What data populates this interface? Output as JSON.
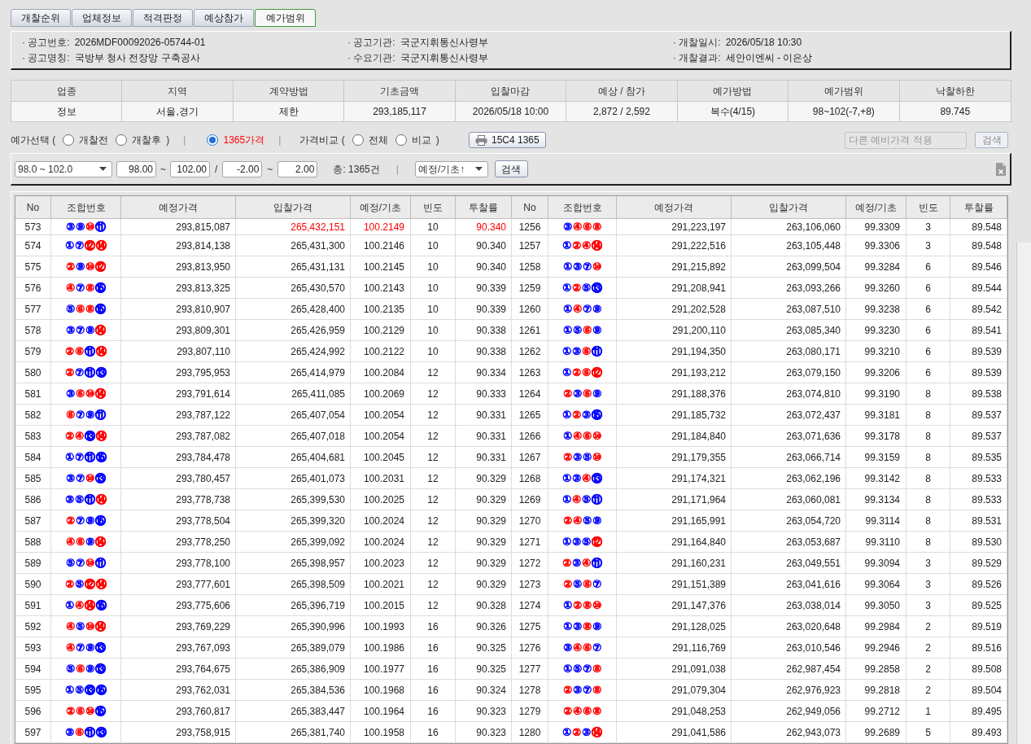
{
  "tabs": [
    {
      "label": "개찰순위",
      "selected": false
    },
    {
      "label": "업체정보",
      "selected": false
    },
    {
      "label": "적격판정",
      "selected": false
    },
    {
      "label": "예상참가",
      "selected": false
    },
    {
      "label": "예가범위",
      "selected": true
    }
  ],
  "notice_info": [
    {
      "label": "· 공고번호:",
      "value": "2026MDF00092026-05744-01"
    },
    {
      "label": "· 공고기관:",
      "value": "국군지휘통신사령부"
    },
    {
      "label": "· 개찰일시:",
      "value": "2026/05/18 10:30"
    },
    {
      "label": "· 공고명칭:",
      "value": "국방부 청사 전장망 구축공사"
    },
    {
      "label": "· 수요기관:",
      "value": "국군지휘통신사령부"
    },
    {
      "label": "· 개찰결과:",
      "value": "세안이엔씨 - 이은상"
    }
  ],
  "summary": {
    "columns": [
      "업종",
      "지역",
      "계약방법",
      "기초금액",
      "입찰마감",
      "예상 / 참가",
      "예가방법",
      "예가범위",
      "낙찰하한"
    ],
    "values": [
      "정보",
      "서울,경기",
      "제한",
      "293,185,117",
      "2026/05/18 10:00",
      "2,872 / 2,592",
      "복수(4/15)",
      "98~102(-7,+8)",
      "89.745"
    ]
  },
  "options": [
    {
      "kind": "text",
      "text": "예가선택 ("
    },
    {
      "kind": "radio",
      "label": "개찰전",
      "selected": false
    },
    {
      "kind": "radio",
      "label": "개찰후",
      "selected": false
    },
    {
      "kind": "text",
      "text": ")"
    },
    {
      "kind": "separator",
      "text": "|"
    },
    {
      "kind": "radio",
      "label": "1365가격",
      "selected": true
    },
    {
      "kind": "separator",
      "text": "|"
    },
    {
      "kind": "text",
      "text": "가격비교 ("
    },
    {
      "kind": "radio",
      "label": "전체",
      "selected": false
    },
    {
      "kind": "radio",
      "label": "비교",
      "selected": false
    },
    {
      "kind": "text",
      "text": ")"
    }
  ],
  "toolbar": {
    "print_button": "15C4 1365",
    "other_price": {
      "placeholder": "다른 예비가격 적용",
      "disabled": true
    },
    "search_button": {
      "label": "검색",
      "disabled": true
    }
  },
  "filter": {
    "range_select": "98.0 ~ 102.0",
    "base_from": "98.00",
    "base_tilde": "~",
    "base_to": "102.00",
    "slash": "/",
    "offset_from": "-2.00",
    "offset_tilde": "~",
    "offset_to": "2.00",
    "total": "총: 1365건",
    "separator": "|",
    "sort_select": "예정/기초↑",
    "search_button": "검색"
  },
  "table": {
    "columns": [
      "No",
      "조합번호",
      "예정가격",
      "입찰가격",
      "예정/기초",
      "빈도",
      "투찰률",
      "No",
      "조합번호",
      "예정가격",
      "입찰가격",
      "예정/기초",
      "빈도",
      "투찰률"
    ],
    "rows": [
      {
        "left": {
          "no": "573",
          "combo": [
            {
              "number": "③",
              "color": "#0000ff"
            },
            {
              "number": "⑨",
              "color": "#0000ff"
            },
            {
              "number": "⑩",
              "color": "#ff0000"
            },
            {
              "number": "⑪",
              "color": "#0000ff"
            }
          ],
          "estimated_price": "293,815,087",
          "bid_price": "265,432,151",
          "ratio": "100.2149",
          "frequency": "10",
          "bid_rate": "90.340",
          "highlighted": true
        },
        "right": {
          "no": "1256",
          "combo": [
            {
              "number": "③",
              "color": "#0000ff"
            },
            {
              "number": "④",
              "color": "#ff0000"
            },
            {
              "number": "⑥",
              "color": "#ff0000"
            },
            {
              "number": "⑧",
              "color": "#ff0000"
            }
          ],
          "estimated_price": "291,223,197",
          "bid_price": "263,106,060",
          "ratio": "99.3309",
          "frequency": "3",
          "bid_rate": "89.548",
          "highlighted": false
        }
      },
      {
        "left": {
          "no": "574",
          "combo": [
            {
              "number": "①",
              "color": "#0000ff"
            },
            {
              "number": "⑦",
              "color": "#0000ff"
            },
            {
              "number": "⑫",
              "color": "#ff0000"
            },
            {
              "number": "⑭",
              "color": "#ff0000"
            }
          ],
          "estimated_price": "293,814,138",
          "bid_price": "265,431,300",
          "ratio": "100.2146",
          "frequency": "10",
          "bid_rate": "90.340",
          "highlighted": false
        },
        "right": {
          "no": "1257",
          "combo": [
            {
              "number": "①",
              "color": "#0000ff"
            },
            {
              "number": "②",
              "color": "#ff0000"
            },
            {
              "number": "④",
              "color": "#ff0000"
            },
            {
              "number": "⑭",
              "color": "#ff0000"
            }
          ],
          "estimated_price": "291,222,516",
          "bid_price": "263,105,448",
          "ratio": "99.3306",
          "frequency": "3",
          "bid_rate": "89.548",
          "highlighted": false
        }
      },
      {
        "left": {
          "no": "575",
          "combo": [
            {
              "number": "②",
              "color": "#ff0000"
            },
            {
              "number": "⑨",
              "color": "#0000ff"
            },
            {
              "number": "⑩",
              "color": "#ff0000"
            },
            {
              "number": "⑫",
              "color": "#ff0000"
            }
          ],
          "estimated_price": "293,813,950",
          "bid_price": "265,431,131",
          "ratio": "100.2145",
          "frequency": "10",
          "bid_rate": "90.340",
          "highlighted": false
        },
        "right": {
          "no": "1258",
          "combo": [
            {
              "number": "①",
              "color": "#0000ff"
            },
            {
              "number": "③",
              "color": "#0000ff"
            },
            {
              "number": "⑦",
              "color": "#0000ff"
            },
            {
              "number": "⑩",
              "color": "#ff0000"
            }
          ],
          "estimated_price": "291,215,892",
          "bid_price": "263,099,504",
          "ratio": "99.3284",
          "frequency": "6",
          "bid_rate": "89.546",
          "highlighted": false
        }
      },
      {
        "left": {
          "no": "576",
          "combo": [
            {
              "number": "④",
              "color": "#ff0000"
            },
            {
              "number": "⑦",
              "color": "#0000ff"
            },
            {
              "number": "⑧",
              "color": "#ff0000"
            },
            {
              "number": "⑮",
              "color": "#0000ff"
            }
          ],
          "estimated_price": "293,813,325",
          "bid_price": "265,430,570",
          "ratio": "100.2143",
          "frequency": "10",
          "bid_rate": "90.339",
          "highlighted": false
        },
        "right": {
          "no": "1259",
          "combo": [
            {
              "number": "①",
              "color": "#0000ff"
            },
            {
              "number": "②",
              "color": "#ff0000"
            },
            {
              "number": "⑤",
              "color": "#0000ff"
            },
            {
              "number": "⑬",
              "color": "#0000ff"
            }
          ],
          "estimated_price": "291,208,941",
          "bid_price": "263,093,266",
          "ratio": "99.3260",
          "frequency": "6",
          "bid_rate": "89.544",
          "highlighted": false
        }
      },
      {
        "left": {
          "no": "577",
          "combo": [
            {
              "number": "⑤",
              "color": "#0000ff"
            },
            {
              "number": "⑥",
              "color": "#ff0000"
            },
            {
              "number": "⑧",
              "color": "#ff0000"
            },
            {
              "number": "⑮",
              "color": "#0000ff"
            }
          ],
          "estimated_price": "293,810,907",
          "bid_price": "265,428,400",
          "ratio": "100.2135",
          "frequency": "10",
          "bid_rate": "90.339",
          "highlighted": false
        },
        "right": {
          "no": "1260",
          "combo": [
            {
              "number": "①",
              "color": "#0000ff"
            },
            {
              "number": "④",
              "color": "#ff0000"
            },
            {
              "number": "⑦",
              "color": "#0000ff"
            },
            {
              "number": "⑨",
              "color": "#0000ff"
            }
          ],
          "estimated_price": "291,202,528",
          "bid_price": "263,087,510",
          "ratio": "99.3238",
          "frequency": "6",
          "bid_rate": "89.542",
          "highlighted": false
        }
      },
      {
        "left": {
          "no": "578",
          "combo": [
            {
              "number": "③",
              "color": "#0000ff"
            },
            {
              "number": "⑦",
              "color": "#0000ff"
            },
            {
              "number": "⑨",
              "color": "#0000ff"
            },
            {
              "number": "⑭",
              "color": "#ff0000"
            }
          ],
          "estimated_price": "293,809,301",
          "bid_price": "265,426,959",
          "ratio": "100.2129",
          "frequency": "10",
          "bid_rate": "90.338",
          "highlighted": false
        },
        "right": {
          "no": "1261",
          "combo": [
            {
              "number": "①",
              "color": "#0000ff"
            },
            {
              "number": "⑤",
              "color": "#0000ff"
            },
            {
              "number": "⑥",
              "color": "#ff0000"
            },
            {
              "number": "⑨",
              "color": "#0000ff"
            }
          ],
          "estimated_price": "291,200,110",
          "bid_price": "263,085,340",
          "ratio": "99.3230",
          "frequency": "6",
          "bid_rate": "89.541",
          "highlighted": false
        }
      },
      {
        "left": {
          "no": "579",
          "combo": [
            {
              "number": "②",
              "color": "#ff0000"
            },
            {
              "number": "⑥",
              "color": "#ff0000"
            },
            {
              "number": "⑪",
              "color": "#0000ff"
            },
            {
              "number": "⑭",
              "color": "#ff0000"
            }
          ],
          "estimated_price": "293,807,110",
          "bid_price": "265,424,992",
          "ratio": "100.2122",
          "frequency": "10",
          "bid_rate": "90.338",
          "highlighted": false
        },
        "right": {
          "no": "1262",
          "combo": [
            {
              "number": "①",
              "color": "#0000ff"
            },
            {
              "number": "③",
              "color": "#0000ff"
            },
            {
              "number": "⑥",
              "color": "#ff0000"
            },
            {
              "number": "⑪",
              "color": "#0000ff"
            }
          ],
          "estimated_price": "291,194,350",
          "bid_price": "263,080,171",
          "ratio": "99.3210",
          "frequency": "6",
          "bid_rate": "89.539",
          "highlighted": false
        }
      },
      {
        "left": {
          "no": "580",
          "combo": [
            {
              "number": "②",
              "color": "#ff0000"
            },
            {
              "number": "⑦",
              "color": "#0000ff"
            },
            {
              "number": "⑪",
              "color": "#0000ff"
            },
            {
              "number": "⑬",
              "color": "#0000ff"
            }
          ],
          "estimated_price": "293,795,953",
          "bid_price": "265,414,979",
          "ratio": "100.2084",
          "frequency": "12",
          "bid_rate": "90.334",
          "highlighted": false
        },
        "right": {
          "no": "1263",
          "combo": [
            {
              "number": "①",
              "color": "#0000ff"
            },
            {
              "number": "②",
              "color": "#ff0000"
            },
            {
              "number": "⑥",
              "color": "#ff0000"
            },
            {
              "number": "⑫",
              "color": "#ff0000"
            }
          ],
          "estimated_price": "291,193,212",
          "bid_price": "263,079,150",
          "ratio": "99.3206",
          "frequency": "6",
          "bid_rate": "89.539",
          "highlighted": false
        }
      },
      {
        "left": {
          "no": "581",
          "combo": [
            {
              "number": "③",
              "color": "#0000ff"
            },
            {
              "number": "⑥",
              "color": "#ff0000"
            },
            {
              "number": "⑩",
              "color": "#ff0000"
            },
            {
              "number": "⑭",
              "color": "#ff0000"
            }
          ],
          "estimated_price": "293,791,614",
          "bid_price": "265,411,085",
          "ratio": "100.2069",
          "frequency": "12",
          "bid_rate": "90.333",
          "highlighted": false
        },
        "right": {
          "no": "1264",
          "combo": [
            {
              "number": "②",
              "color": "#ff0000"
            },
            {
              "number": "③",
              "color": "#0000ff"
            },
            {
              "number": "⑥",
              "color": "#ff0000"
            },
            {
              "number": "⑨",
              "color": "#0000ff"
            }
          ],
          "estimated_price": "291,188,376",
          "bid_price": "263,074,810",
          "ratio": "99.3190",
          "frequency": "8",
          "bid_rate": "89.538",
          "highlighted": false
        }
      },
      {
        "left": {
          "no": "582",
          "combo": [
            {
              "number": "⑥",
              "color": "#ff0000"
            },
            {
              "number": "⑦",
              "color": "#0000ff"
            },
            {
              "number": "⑨",
              "color": "#0000ff"
            },
            {
              "number": "⑪",
              "color": "#0000ff"
            }
          ],
          "estimated_price": "293,787,122",
          "bid_price": "265,407,054",
          "ratio": "100.2054",
          "frequency": "12",
          "bid_rate": "90.331",
          "highlighted": false
        },
        "right": {
          "no": "1265",
          "combo": [
            {
              "number": "①",
              "color": "#0000ff"
            },
            {
              "number": "②",
              "color": "#ff0000"
            },
            {
              "number": "③",
              "color": "#0000ff"
            },
            {
              "number": "⑮",
              "color": "#0000ff"
            }
          ],
          "estimated_price": "291,185,732",
          "bid_price": "263,072,437",
          "ratio": "99.3181",
          "frequency": "8",
          "bid_rate": "89.537",
          "highlighted": false
        }
      },
      {
        "left": {
          "no": "583",
          "combo": [
            {
              "number": "②",
              "color": "#ff0000"
            },
            {
              "number": "④",
              "color": "#ff0000"
            },
            {
              "number": "⑬",
              "color": "#0000ff"
            },
            {
              "number": "⑭",
              "color": "#ff0000"
            }
          ],
          "estimated_price": "293,787,082",
          "bid_price": "265,407,018",
          "ratio": "100.2054",
          "frequency": "12",
          "bid_rate": "90.331",
          "highlighted": false
        },
        "right": {
          "no": "1266",
          "combo": [
            {
              "number": "①",
              "color": "#0000ff"
            },
            {
              "number": "④",
              "color": "#ff0000"
            },
            {
              "number": "⑥",
              "color": "#ff0000"
            },
            {
              "number": "⑩",
              "color": "#ff0000"
            }
          ],
          "estimated_price": "291,184,840",
          "bid_price": "263,071,636",
          "ratio": "99.3178",
          "frequency": "8",
          "bid_rate": "89.537",
          "highlighted": false
        }
      },
      {
        "left": {
          "no": "584",
          "combo": [
            {
              "number": "①",
              "color": "#0000ff"
            },
            {
              "number": "⑦",
              "color": "#0000ff"
            },
            {
              "number": "⑪",
              "color": "#0000ff"
            },
            {
              "number": "⑮",
              "color": "#0000ff"
            }
          ],
          "estimated_price": "293,784,478",
          "bid_price": "265,404,681",
          "ratio": "100.2045",
          "frequency": "12",
          "bid_rate": "90.331",
          "highlighted": false
        },
        "right": {
          "no": "1267",
          "combo": [
            {
              "number": "②",
              "color": "#ff0000"
            },
            {
              "number": "③",
              "color": "#0000ff"
            },
            {
              "number": "⑤",
              "color": "#0000ff"
            },
            {
              "number": "⑩",
              "color": "#ff0000"
            }
          ],
          "estimated_price": "291,179,355",
          "bid_price": "263,066,714",
          "ratio": "99.3159",
          "frequency": "8",
          "bid_rate": "89.535",
          "highlighted": false
        }
      },
      {
        "left": {
          "no": "585",
          "combo": [
            {
              "number": "③",
              "color": "#0000ff"
            },
            {
              "number": "⑦",
              "color": "#0000ff"
            },
            {
              "number": "⑩",
              "color": "#ff0000"
            },
            {
              "number": "⑬",
              "color": "#0000ff"
            }
          ],
          "estimated_price": "293,780,457",
          "bid_price": "265,401,073",
          "ratio": "100.2031",
          "frequency": "12",
          "bid_rate": "90.329",
          "highlighted": false
        },
        "right": {
          "no": "1268",
          "combo": [
            {
              "number": "①",
              "color": "#0000ff"
            },
            {
              "number": "③",
              "color": "#0000ff"
            },
            {
              "number": "④",
              "color": "#ff0000"
            },
            {
              "number": "⑬",
              "color": "#0000ff"
            }
          ],
          "estimated_price": "291,174,321",
          "bid_price": "263,062,196",
          "ratio": "99.3142",
          "frequency": "8",
          "bid_rate": "89.533",
          "highlighted": false
        }
      },
      {
        "left": {
          "no": "586",
          "combo": [
            {
              "number": "③",
              "color": "#0000ff"
            },
            {
              "number": "⑤",
              "color": "#0000ff"
            },
            {
              "number": "⑪",
              "color": "#0000ff"
            },
            {
              "number": "⑭",
              "color": "#ff0000"
            }
          ],
          "estimated_price": "293,778,738",
          "bid_price": "265,399,530",
          "ratio": "100.2025",
          "frequency": "12",
          "bid_rate": "90.329",
          "highlighted": false
        },
        "right": {
          "no": "1269",
          "combo": [
            {
              "number": "①",
              "color": "#0000ff"
            },
            {
              "number": "④",
              "color": "#ff0000"
            },
            {
              "number": "⑤",
              "color": "#0000ff"
            },
            {
              "number": "⑪",
              "color": "#0000ff"
            }
          ],
          "estimated_price": "291,171,964",
          "bid_price": "263,060,081",
          "ratio": "99.3134",
          "frequency": "8",
          "bid_rate": "89.533",
          "highlighted": false
        }
      },
      {
        "left": {
          "no": "587",
          "combo": [
            {
              "number": "②",
              "color": "#ff0000"
            },
            {
              "number": "⑦",
              "color": "#0000ff"
            },
            {
              "number": "⑨",
              "color": "#0000ff"
            },
            {
              "number": "⑮",
              "color": "#0000ff"
            }
          ],
          "estimated_price": "293,778,504",
          "bid_price": "265,399,320",
          "ratio": "100.2024",
          "frequency": "12",
          "bid_rate": "90.329",
          "highlighted": false
        },
        "right": {
          "no": "1270",
          "combo": [
            {
              "number": "②",
              "color": "#ff0000"
            },
            {
              "number": "④",
              "color": "#ff0000"
            },
            {
              "number": "⑤",
              "color": "#0000ff"
            },
            {
              "number": "⑨",
              "color": "#0000ff"
            }
          ],
          "estimated_price": "291,165,991",
          "bid_price": "263,054,720",
          "ratio": "99.3114",
          "frequency": "8",
          "bid_rate": "89.531",
          "highlighted": false
        }
      },
      {
        "left": {
          "no": "588",
          "combo": [
            {
              "number": "④",
              "color": "#ff0000"
            },
            {
              "number": "⑥",
              "color": "#ff0000"
            },
            {
              "number": "⑨",
              "color": "#0000ff"
            },
            {
              "number": "⑭",
              "color": "#ff0000"
            }
          ],
          "estimated_price": "293,778,250",
          "bid_price": "265,399,092",
          "ratio": "100.2024",
          "frequency": "12",
          "bid_rate": "90.329",
          "highlighted": false
        },
        "right": {
          "no": "1271",
          "combo": [
            {
              "number": "①",
              "color": "#0000ff"
            },
            {
              "number": "③",
              "color": "#0000ff"
            },
            {
              "number": "⑤",
              "color": "#0000ff"
            },
            {
              "number": "⑫",
              "color": "#ff0000"
            }
          ],
          "estimated_price": "291,164,840",
          "bid_price": "263,053,687",
          "ratio": "99.3110",
          "frequency": "8",
          "bid_rate": "89.530",
          "highlighted": false
        }
      },
      {
        "left": {
          "no": "589",
          "combo": [
            {
              "number": "⑤",
              "color": "#0000ff"
            },
            {
              "number": "⑦",
              "color": "#0000ff"
            },
            {
              "number": "⑩",
              "color": "#ff0000"
            },
            {
              "number": "⑪",
              "color": "#0000ff"
            }
          ],
          "estimated_price": "293,778,100",
          "bid_price": "265,398,957",
          "ratio": "100.2023",
          "frequency": "12",
          "bid_rate": "90.329",
          "highlighted": false
        },
        "right": {
          "no": "1272",
          "combo": [
            {
              "number": "②",
              "color": "#ff0000"
            },
            {
              "number": "③",
              "color": "#0000ff"
            },
            {
              "number": "④",
              "color": "#ff0000"
            },
            {
              "number": "⑪",
              "color": "#0000ff"
            }
          ],
          "estimated_price": "291,160,231",
          "bid_price": "263,049,551",
          "ratio": "99.3094",
          "frequency": "3",
          "bid_rate": "89.529",
          "highlighted": false
        }
      },
      {
        "left": {
          "no": "590",
          "combo": [
            {
              "number": "②",
              "color": "#ff0000"
            },
            {
              "number": "⑤",
              "color": "#0000ff"
            },
            {
              "number": "⑫",
              "color": "#ff0000"
            },
            {
              "number": "⑭",
              "color": "#ff0000"
            }
          ],
          "estimated_price": "293,777,601",
          "bid_price": "265,398,509",
          "ratio": "100.2021",
          "frequency": "12",
          "bid_rate": "90.329",
          "highlighted": false
        },
        "right": {
          "no": "1273",
          "combo": [
            {
              "number": "②",
              "color": "#ff0000"
            },
            {
              "number": "⑤",
              "color": "#0000ff"
            },
            {
              "number": "⑥",
              "color": "#ff0000"
            },
            {
              "number": "⑦",
              "color": "#0000ff"
            }
          ],
          "estimated_price": "291,151,389",
          "bid_price": "263,041,616",
          "ratio": "99.3064",
          "frequency": "3",
          "bid_rate": "89.526",
          "highlighted": false
        }
      },
      {
        "left": {
          "no": "591",
          "combo": [
            {
              "number": "①",
              "color": "#0000ff"
            },
            {
              "number": "④",
              "color": "#ff0000"
            },
            {
              "number": "⑭",
              "color": "#ff0000"
            },
            {
              "number": "⑮",
              "color": "#0000ff"
            }
          ],
          "estimated_price": "293,775,606",
          "bid_price": "265,396,719",
          "ratio": "100.2015",
          "frequency": "12",
          "bid_rate": "90.328",
          "highlighted": false
        },
        "right": {
          "no": "1274",
          "combo": [
            {
              "number": "①",
              "color": "#0000ff"
            },
            {
              "number": "②",
              "color": "#ff0000"
            },
            {
              "number": "⑧",
              "color": "#ff0000"
            },
            {
              "number": "⑩",
              "color": "#ff0000"
            }
          ],
          "estimated_price": "291,147,376",
          "bid_price": "263,038,014",
          "ratio": "99.3050",
          "frequency": "3",
          "bid_rate": "89.525",
          "highlighted": false
        }
      },
      {
        "left": {
          "no": "592",
          "combo": [
            {
              "number": "④",
              "color": "#ff0000"
            },
            {
              "number": "⑤",
              "color": "#0000ff"
            },
            {
              "number": "⑩",
              "color": "#ff0000"
            },
            {
              "number": "⑭",
              "color": "#ff0000"
            }
          ],
          "estimated_price": "293,769,229",
          "bid_price": "265,390,996",
          "ratio": "100.1993",
          "frequency": "16",
          "bid_rate": "90.326",
          "highlighted": false
        },
        "right": {
          "no": "1275",
          "combo": [
            {
              "number": "①",
              "color": "#0000ff"
            },
            {
              "number": "③",
              "color": "#0000ff"
            },
            {
              "number": "⑧",
              "color": "#ff0000"
            },
            {
              "number": "⑨",
              "color": "#0000ff"
            }
          ],
          "estimated_price": "291,128,025",
          "bid_price": "263,020,648",
          "ratio": "99.2984",
          "frequency": "2",
          "bid_rate": "89.519",
          "highlighted": false
        }
      },
      {
        "left": {
          "no": "593",
          "combo": [
            {
              "number": "④",
              "color": "#ff0000"
            },
            {
              "number": "⑦",
              "color": "#0000ff"
            },
            {
              "number": "⑨",
              "color": "#0000ff"
            },
            {
              "number": "⑬",
              "color": "#0000ff"
            }
          ],
          "estimated_price": "293,767,093",
          "bid_price": "265,389,079",
          "ratio": "100.1986",
          "frequency": "16",
          "bid_rate": "90.325",
          "highlighted": false
        },
        "right": {
          "no": "1276",
          "combo": [
            {
              "number": "③",
              "color": "#0000ff"
            },
            {
              "number": "④",
              "color": "#ff0000"
            },
            {
              "number": "⑥",
              "color": "#ff0000"
            },
            {
              "number": "⑦",
              "color": "#0000ff"
            }
          ],
          "estimated_price": "291,116,769",
          "bid_price": "263,010,546",
          "ratio": "99.2946",
          "frequency": "2",
          "bid_rate": "89.516",
          "highlighted": false
        }
      },
      {
        "left": {
          "no": "594",
          "combo": [
            {
              "number": "⑤",
              "color": "#0000ff"
            },
            {
              "number": "⑥",
              "color": "#ff0000"
            },
            {
              "number": "⑨",
              "color": "#0000ff"
            },
            {
              "number": "⑬",
              "color": "#0000ff"
            }
          ],
          "estimated_price": "293,764,675",
          "bid_price": "265,386,909",
          "ratio": "100.1977",
          "frequency": "16",
          "bid_rate": "90.325",
          "highlighted": false
        },
        "right": {
          "no": "1277",
          "combo": [
            {
              "number": "①",
              "color": "#0000ff"
            },
            {
              "number": "⑤",
              "color": "#0000ff"
            },
            {
              "number": "⑦",
              "color": "#0000ff"
            },
            {
              "number": "⑧",
              "color": "#ff0000"
            }
          ],
          "estimated_price": "291,091,038",
          "bid_price": "262,987,454",
          "ratio": "99.2858",
          "frequency": "2",
          "bid_rate": "89.508",
          "highlighted": false
        }
      },
      {
        "left": {
          "no": "595",
          "combo": [
            {
              "number": "①",
              "color": "#0000ff"
            },
            {
              "number": "⑤",
              "color": "#0000ff"
            },
            {
              "number": "⑬",
              "color": "#0000ff"
            },
            {
              "number": "⑮",
              "color": "#0000ff"
            }
          ],
          "estimated_price": "293,762,031",
          "bid_price": "265,384,536",
          "ratio": "100.1968",
          "frequency": "16",
          "bid_rate": "90.324",
          "highlighted": false
        },
        "right": {
          "no": "1278",
          "combo": [
            {
              "number": "②",
              "color": "#ff0000"
            },
            {
              "number": "③",
              "color": "#0000ff"
            },
            {
              "number": "⑦",
              "color": "#0000ff"
            },
            {
              "number": "⑧",
              "color": "#ff0000"
            }
          ],
          "estimated_price": "291,079,304",
          "bid_price": "262,976,923",
          "ratio": "99.2818",
          "frequency": "2",
          "bid_rate": "89.504",
          "highlighted": false
        }
      },
      {
        "left": {
          "no": "596",
          "combo": [
            {
              "number": "②",
              "color": "#ff0000"
            },
            {
              "number": "⑥",
              "color": "#ff0000"
            },
            {
              "number": "⑩",
              "color": "#ff0000"
            },
            {
              "number": "⑮",
              "color": "#0000ff"
            }
          ],
          "estimated_price": "293,760,817",
          "bid_price": "265,383,447",
          "ratio": "100.1964",
          "frequency": "16",
          "bid_rate": "90.323",
          "highlighted": false
        },
        "right": {
          "no": "1279",
          "combo": [
            {
              "number": "②",
              "color": "#ff0000"
            },
            {
              "number": "④",
              "color": "#ff0000"
            },
            {
              "number": "⑥",
              "color": "#ff0000"
            },
            {
              "number": "⑧",
              "color": "#ff0000"
            }
          ],
          "estimated_price": "291,048,253",
          "bid_price": "262,949,056",
          "ratio": "99.2712",
          "frequency": "1",
          "bid_rate": "89.495",
          "highlighted": false
        }
      },
      {
        "left": {
          "no": "597",
          "combo": [
            {
              "number": "③",
              "color": "#0000ff"
            },
            {
              "number": "⑥",
              "color": "#ff0000"
            },
            {
              "number": "⑪",
              "color": "#0000ff"
            },
            {
              "number": "⑬",
              "color": "#0000ff"
            }
          ],
          "estimated_price": "293,758,915",
          "bid_price": "265,381,740",
          "ratio": "100.1958",
          "frequency": "16",
          "bid_rate": "90.323",
          "highlighted": false
        },
        "right": {
          "no": "1280",
          "combo": [
            {
              "number": "①",
              "color": "#0000ff"
            },
            {
              "number": "②",
              "color": "#ff0000"
            },
            {
              "number": "③",
              "color": "#0000ff"
            },
            {
              "number": "⑭",
              "color": "#ff0000"
            }
          ],
          "estimated_price": "291,041,586",
          "bid_price": "262,943,073",
          "ratio": "99.2689",
          "frequency": "5",
          "bid_rate": "89.493",
          "highlighted": false
        }
      }
    ]
  }
}
